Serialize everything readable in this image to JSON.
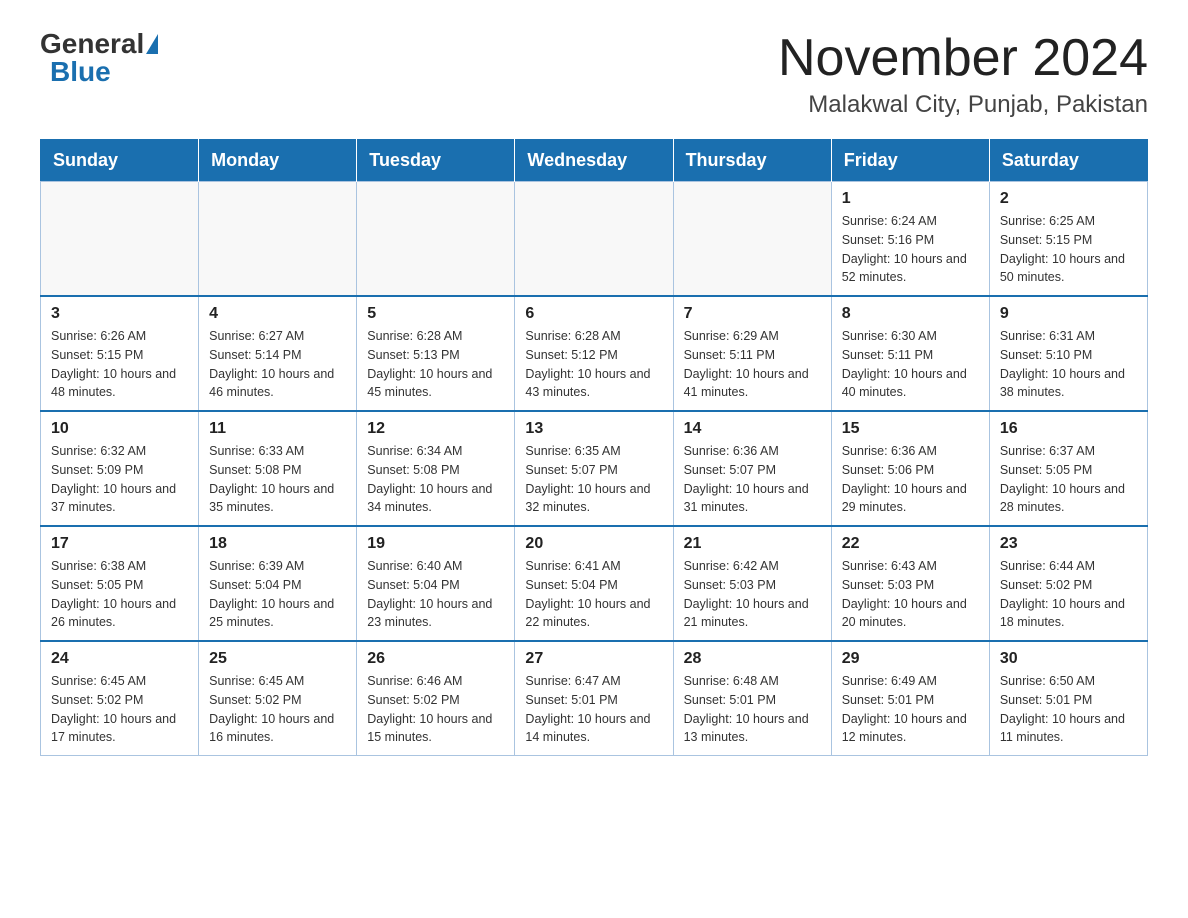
{
  "header": {
    "logo_general": "General",
    "logo_blue": "Blue",
    "month": "November 2024",
    "location": "Malakwal City, Punjab, Pakistan"
  },
  "days_of_week": [
    "Sunday",
    "Monday",
    "Tuesday",
    "Wednesday",
    "Thursday",
    "Friday",
    "Saturday"
  ],
  "weeks": [
    [
      {
        "day": "",
        "info": ""
      },
      {
        "day": "",
        "info": ""
      },
      {
        "day": "",
        "info": ""
      },
      {
        "day": "",
        "info": ""
      },
      {
        "day": "",
        "info": ""
      },
      {
        "day": "1",
        "info": "Sunrise: 6:24 AM\nSunset: 5:16 PM\nDaylight: 10 hours and 52 minutes."
      },
      {
        "day": "2",
        "info": "Sunrise: 6:25 AM\nSunset: 5:15 PM\nDaylight: 10 hours and 50 minutes."
      }
    ],
    [
      {
        "day": "3",
        "info": "Sunrise: 6:26 AM\nSunset: 5:15 PM\nDaylight: 10 hours and 48 minutes."
      },
      {
        "day": "4",
        "info": "Sunrise: 6:27 AM\nSunset: 5:14 PM\nDaylight: 10 hours and 46 minutes."
      },
      {
        "day": "5",
        "info": "Sunrise: 6:28 AM\nSunset: 5:13 PM\nDaylight: 10 hours and 45 minutes."
      },
      {
        "day": "6",
        "info": "Sunrise: 6:28 AM\nSunset: 5:12 PM\nDaylight: 10 hours and 43 minutes."
      },
      {
        "day": "7",
        "info": "Sunrise: 6:29 AM\nSunset: 5:11 PM\nDaylight: 10 hours and 41 minutes."
      },
      {
        "day": "8",
        "info": "Sunrise: 6:30 AM\nSunset: 5:11 PM\nDaylight: 10 hours and 40 minutes."
      },
      {
        "day": "9",
        "info": "Sunrise: 6:31 AM\nSunset: 5:10 PM\nDaylight: 10 hours and 38 minutes."
      }
    ],
    [
      {
        "day": "10",
        "info": "Sunrise: 6:32 AM\nSunset: 5:09 PM\nDaylight: 10 hours and 37 minutes."
      },
      {
        "day": "11",
        "info": "Sunrise: 6:33 AM\nSunset: 5:08 PM\nDaylight: 10 hours and 35 minutes."
      },
      {
        "day": "12",
        "info": "Sunrise: 6:34 AM\nSunset: 5:08 PM\nDaylight: 10 hours and 34 minutes."
      },
      {
        "day": "13",
        "info": "Sunrise: 6:35 AM\nSunset: 5:07 PM\nDaylight: 10 hours and 32 minutes."
      },
      {
        "day": "14",
        "info": "Sunrise: 6:36 AM\nSunset: 5:07 PM\nDaylight: 10 hours and 31 minutes."
      },
      {
        "day": "15",
        "info": "Sunrise: 6:36 AM\nSunset: 5:06 PM\nDaylight: 10 hours and 29 minutes."
      },
      {
        "day": "16",
        "info": "Sunrise: 6:37 AM\nSunset: 5:05 PM\nDaylight: 10 hours and 28 minutes."
      }
    ],
    [
      {
        "day": "17",
        "info": "Sunrise: 6:38 AM\nSunset: 5:05 PM\nDaylight: 10 hours and 26 minutes."
      },
      {
        "day": "18",
        "info": "Sunrise: 6:39 AM\nSunset: 5:04 PM\nDaylight: 10 hours and 25 minutes."
      },
      {
        "day": "19",
        "info": "Sunrise: 6:40 AM\nSunset: 5:04 PM\nDaylight: 10 hours and 23 minutes."
      },
      {
        "day": "20",
        "info": "Sunrise: 6:41 AM\nSunset: 5:04 PM\nDaylight: 10 hours and 22 minutes."
      },
      {
        "day": "21",
        "info": "Sunrise: 6:42 AM\nSunset: 5:03 PM\nDaylight: 10 hours and 21 minutes."
      },
      {
        "day": "22",
        "info": "Sunrise: 6:43 AM\nSunset: 5:03 PM\nDaylight: 10 hours and 20 minutes."
      },
      {
        "day": "23",
        "info": "Sunrise: 6:44 AM\nSunset: 5:02 PM\nDaylight: 10 hours and 18 minutes."
      }
    ],
    [
      {
        "day": "24",
        "info": "Sunrise: 6:45 AM\nSunset: 5:02 PM\nDaylight: 10 hours and 17 minutes."
      },
      {
        "day": "25",
        "info": "Sunrise: 6:45 AM\nSunset: 5:02 PM\nDaylight: 10 hours and 16 minutes."
      },
      {
        "day": "26",
        "info": "Sunrise: 6:46 AM\nSunset: 5:02 PM\nDaylight: 10 hours and 15 minutes."
      },
      {
        "day": "27",
        "info": "Sunrise: 6:47 AM\nSunset: 5:01 PM\nDaylight: 10 hours and 14 minutes."
      },
      {
        "day": "28",
        "info": "Sunrise: 6:48 AM\nSunset: 5:01 PM\nDaylight: 10 hours and 13 minutes."
      },
      {
        "day": "29",
        "info": "Sunrise: 6:49 AM\nSunset: 5:01 PM\nDaylight: 10 hours and 12 minutes."
      },
      {
        "day": "30",
        "info": "Sunrise: 6:50 AM\nSunset: 5:01 PM\nDaylight: 10 hours and 11 minutes."
      }
    ]
  ]
}
